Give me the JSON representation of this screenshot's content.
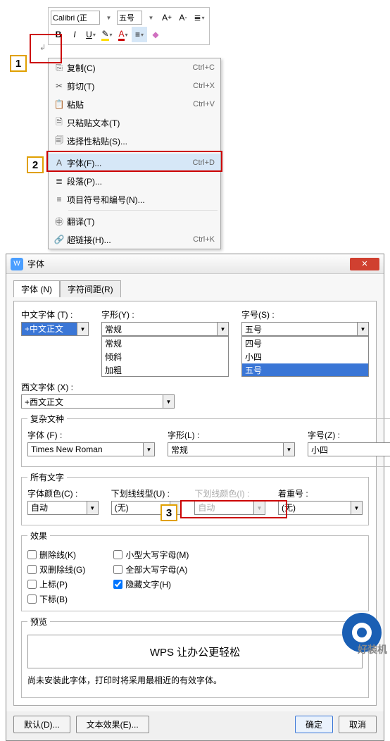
{
  "toolbar": {
    "font_name": "Calibri (正",
    "font_size": "五号",
    "bold": "B",
    "italic": "I",
    "underline": "U"
  },
  "markers": {
    "m1": "1",
    "m2": "2",
    "m3": "3"
  },
  "context_menu": [
    {
      "icon": "⎘",
      "label": "复制(C)",
      "shortcut": "Ctrl+C"
    },
    {
      "icon": "✂",
      "label": "剪切(T)",
      "shortcut": "Ctrl+X"
    },
    {
      "icon": "📋",
      "label": "粘贴",
      "shortcut": "Ctrl+V"
    },
    {
      "icon": "🗎",
      "label": "只粘贴文本(T)",
      "shortcut": ""
    },
    {
      "icon": "🗐",
      "label": "选择性粘贴(S)...",
      "shortcut": ""
    },
    {
      "sep": true
    },
    {
      "icon": "A",
      "label": "字体(F)...",
      "shortcut": "Ctrl+D",
      "hl": true
    },
    {
      "icon": "≣",
      "label": "段落(P)...",
      "shortcut": ""
    },
    {
      "icon": "≡",
      "label": "项目符号和编号(N)...",
      "shortcut": ""
    },
    {
      "sep": true
    },
    {
      "icon": "㊥",
      "label": "翻译(T)",
      "shortcut": ""
    },
    {
      "icon": "🔗",
      "label": "超链接(H)...",
      "shortcut": "Ctrl+K"
    }
  ],
  "dialog": {
    "title": "字体",
    "tabs": {
      "font": "字体 (N)",
      "spacing": "字符间距(R)"
    },
    "cn_font_lbl": "中文字体 (T) :",
    "cn_font_val": "+中文正文",
    "style_lbl": "字形(Y) :",
    "style_val": "常规",
    "style_opts": [
      "常规",
      "倾斜",
      "加粗"
    ],
    "size_lbl": "字号(S) :",
    "size_val": "五号",
    "size_opts": [
      "四号",
      "小四",
      "五号"
    ],
    "en_font_lbl": "西文字体 (X) :",
    "en_font_val": "+西文正文",
    "complex_legend": "复杂文种",
    "complex_font_lbl": "字体 (F) :",
    "complex_font_val": "Times New Roman",
    "complex_style_lbl": "字形(L) :",
    "complex_style_val": "常规",
    "complex_size_lbl": "字号(Z) :",
    "complex_size_val": "小四",
    "all_text_legend": "所有文字",
    "color_lbl": "字体颜色(C) :",
    "color_val": "自动",
    "under_lbl": "下划线线型(U) :",
    "under_val": "(无)",
    "under_color_lbl": "下划线颜色(I) :",
    "under_color_val": "自动",
    "emph_lbl": "着重号 :",
    "emph_val": "(无)",
    "effects_legend": "效果",
    "effects_left": [
      "删除线(K)",
      "双删除线(G)",
      "上标(P)",
      "下标(B)"
    ],
    "effects_right": [
      "小型大写字母(M)",
      "全部大写字母(A)",
      "隐藏文字(H)"
    ],
    "preview_legend": "预览",
    "preview_text": "WPS 让办公更轻松",
    "note_text": "尚未安装此字体，打印时将采用最相近的有效字体。",
    "btn_default": "默认(D)...",
    "btn_texteffect": "文本效果(E)...",
    "btn_ok": "确定",
    "btn_cancel": "取消"
  },
  "watermark": "好装机"
}
